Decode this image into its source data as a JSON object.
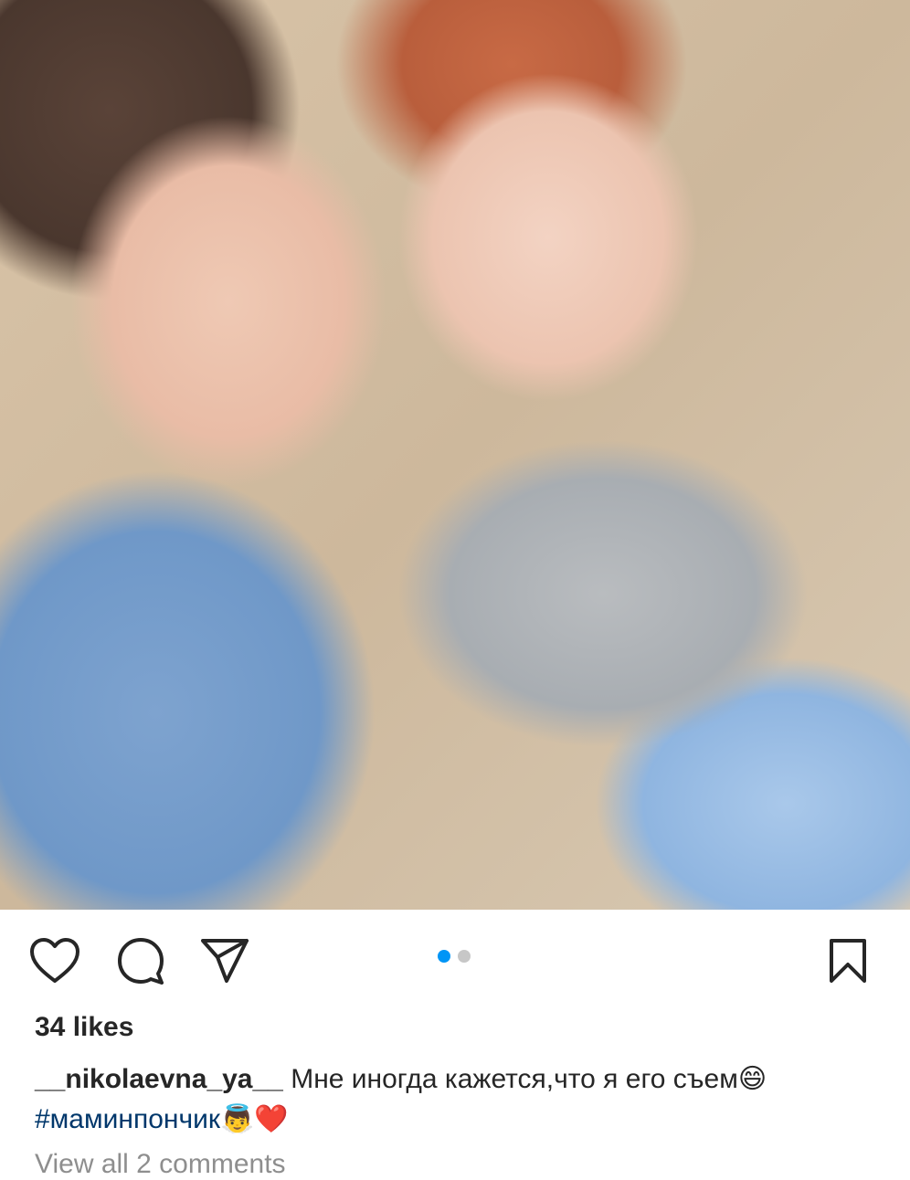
{
  "post": {
    "likes_text": "34 likes",
    "username": "__nikolaevna_ya__",
    "caption_text": "Мне иногда кажется,что я его съем",
    "caption_emoji": "😄",
    "hashtag": "#маминпончик",
    "hashtag_emojis": "👼❤️",
    "view_comments": "View all 2 comments"
  },
  "carousel": {
    "current": 1,
    "total": 2
  },
  "icons": {
    "like": "heart-icon",
    "comment": "comment-icon",
    "share": "send-icon",
    "save": "bookmark-icon"
  },
  "colors": {
    "text": "#262626",
    "hashtag": "#00376b",
    "dot_active": "#0095f6",
    "dot_inactive": "#c7c7c7",
    "muted": "#8e8e8e"
  }
}
